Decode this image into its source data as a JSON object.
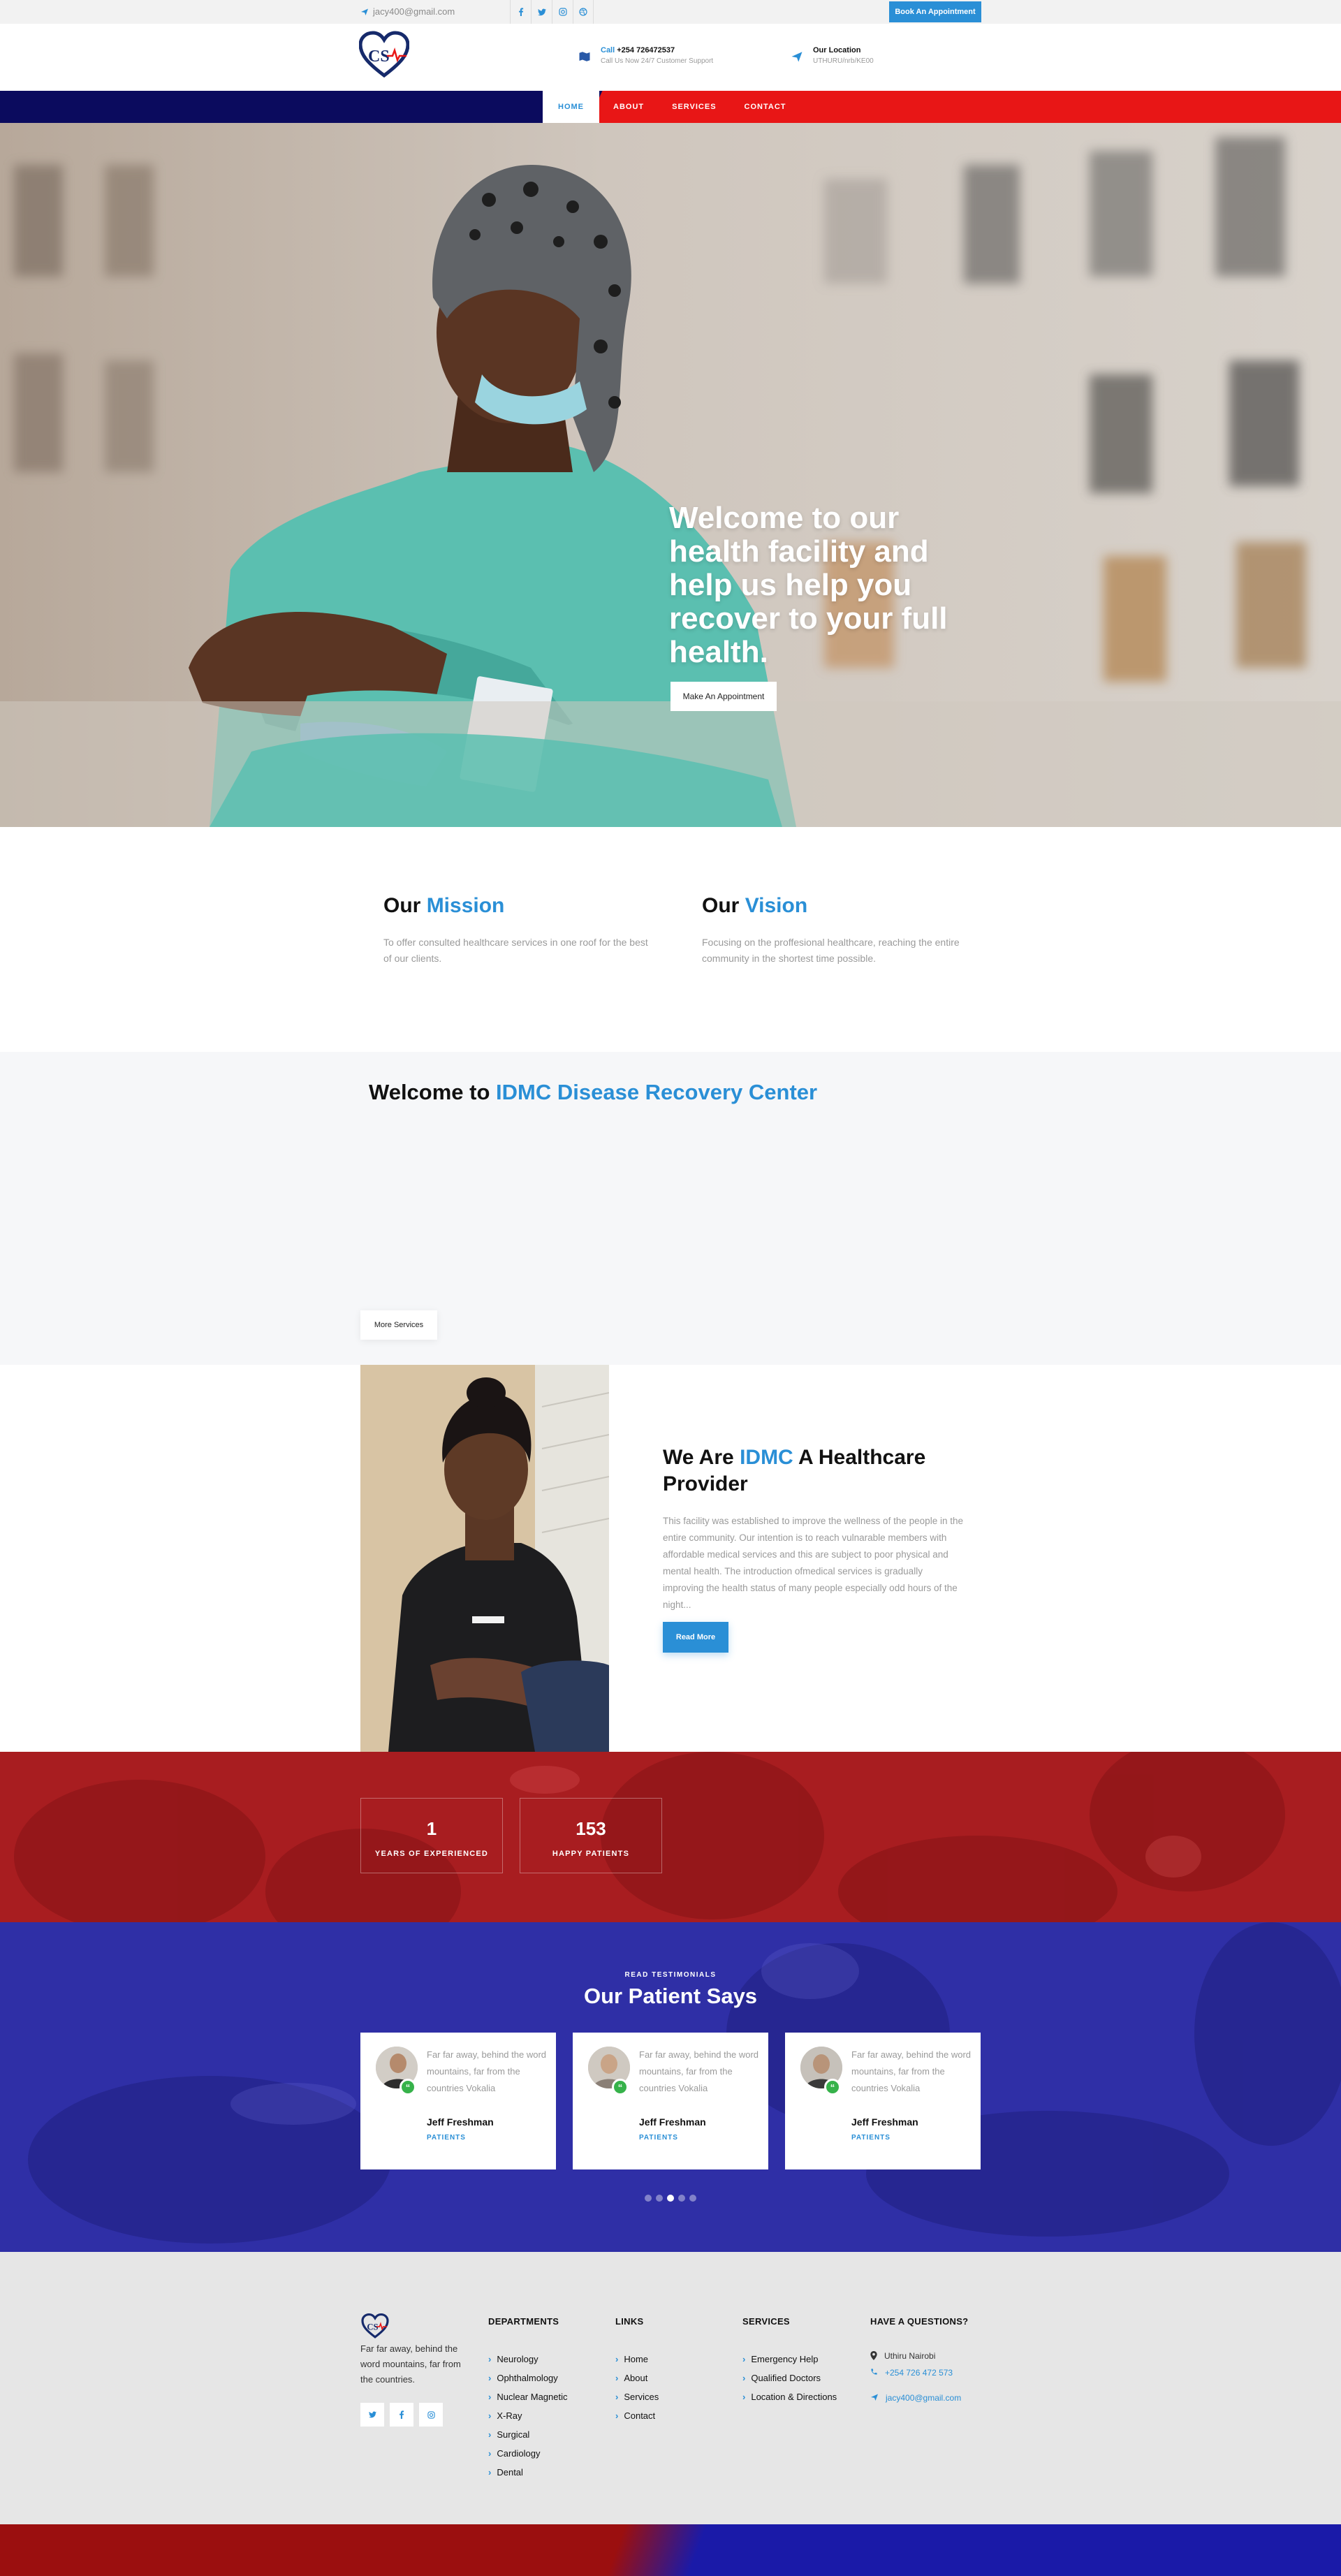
{
  "topbar": {
    "email": "jacy400@gmail.com",
    "socials": [
      "facebook-icon",
      "twitter-icon",
      "instagram-icon",
      "dribbble-icon"
    ],
    "book_button": "Book An Appointment"
  },
  "header": {
    "phone_label": "Call",
    "phone": "+254 726472537",
    "phone_sub": "Call Us Now 24/7 Customer Support",
    "location_title": "Our Location",
    "location_sub": "UTHURU/nrb/KE00"
  },
  "nav": {
    "items": [
      {
        "label": "HOME",
        "active": true
      },
      {
        "label": "ABOUT",
        "active": false
      },
      {
        "label": "SERVICES",
        "active": false
      },
      {
        "label": "CONTACT",
        "active": false
      }
    ]
  },
  "hero": {
    "title": "Welcome to our health facility and help us help you recover to your full health.",
    "button": "Make An Appointment"
  },
  "mission": {
    "title_a": "Our",
    "title_b": "Mission",
    "text": "To offer consulted healthcare services in one roof for the best of our clients."
  },
  "vision": {
    "title_a": "Our",
    "title_b": "Vision",
    "text": "Focusing on the proffesional healthcare, reaching the entire community in the shortest time possible."
  },
  "welcome": {
    "title_a": "Welcome to",
    "title_b": "IDMC Disease Recovery Center",
    "button": "More Services"
  },
  "about": {
    "title_a": "We Are",
    "title_b": "IDMC",
    "title_c": "A Healthcare Provider",
    "text": "This facility was established to improve the wellness of the people in the entire community. Our intention is to reach vulnarable members with affordable medical services and this are subject to poor physical and mental health. The introduction ofmedical services is gradually improving the health status of many people especially odd hours of the night...",
    "button": "Read More"
  },
  "stats": [
    {
      "value": "1",
      "label": "YEARS OF EXPERIENCED"
    },
    {
      "value": "153",
      "label": "HAPPY PATIENTS"
    }
  ],
  "testimonials": {
    "kicker": "READ TESTIMONIALS",
    "title": "Our Patient Says",
    "items": [
      {
        "text": "Far far away, behind the word mountains, far from the countries Vokalia",
        "name": "Jeff Freshman",
        "role": "PATIENTS"
      },
      {
        "text": "Far far away, behind the word mountains, far from the countries Vokalia",
        "name": "Jeff Freshman",
        "role": "PATIENTS"
      },
      {
        "text": "Far far away, behind the word mountains, far from the countries Vokalia",
        "name": "Jeff Freshman",
        "role": "PATIENTS"
      }
    ],
    "dots": 5,
    "active_dot": 3
  },
  "footer": {
    "about": "Far far away, behind the word mountains, far from the countries.",
    "socials": [
      "twitter-icon",
      "facebook-icon",
      "instagram-icon"
    ],
    "departments_title": "DEPARTMENTS",
    "departments": [
      "Neurology",
      "Ophthalmology",
      "Nuclear Magnetic",
      "X-Ray",
      "Surgical",
      "Cardiology",
      "Dental"
    ],
    "links_title": "LINKS",
    "links": [
      "Home",
      "About",
      "Services",
      "Contact"
    ],
    "services_title": "SERVICES",
    "services": [
      "Emergency Help",
      "Qualified Doctors",
      "Location & Directions"
    ],
    "questions_title": "HAVE A QUESTIONS?",
    "address": "Uthiru Nairobi",
    "phone": "+254 726 472 573",
    "email": "jacy400@gmail.com"
  },
  "colors": {
    "accent": "#2a8fd6",
    "navy": "#0b0b5e",
    "red": "#e81616",
    "green": "#36b24a"
  }
}
